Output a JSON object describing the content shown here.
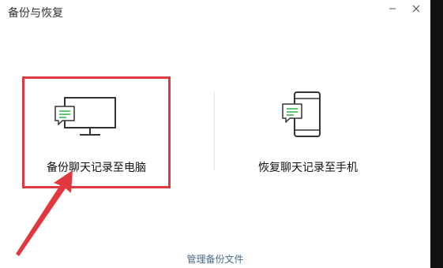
{
  "window": {
    "title": "备份与恢复",
    "minimize_icon": "minimize-icon",
    "close_icon": "close-icon"
  },
  "options": [
    {
      "label": "备份聊天记录至电脑",
      "icon": "computer-chat-icon",
      "highlighted": true
    },
    {
      "label": "恢复聊天记录至手机",
      "icon": "phone-chat-icon",
      "highlighted": false
    }
  ],
  "footer": {
    "manage_link": "管理备份文件"
  },
  "colors": {
    "highlight": "#e0383e",
    "link": "#4a6a8c",
    "icon_accent": "#29b446"
  }
}
